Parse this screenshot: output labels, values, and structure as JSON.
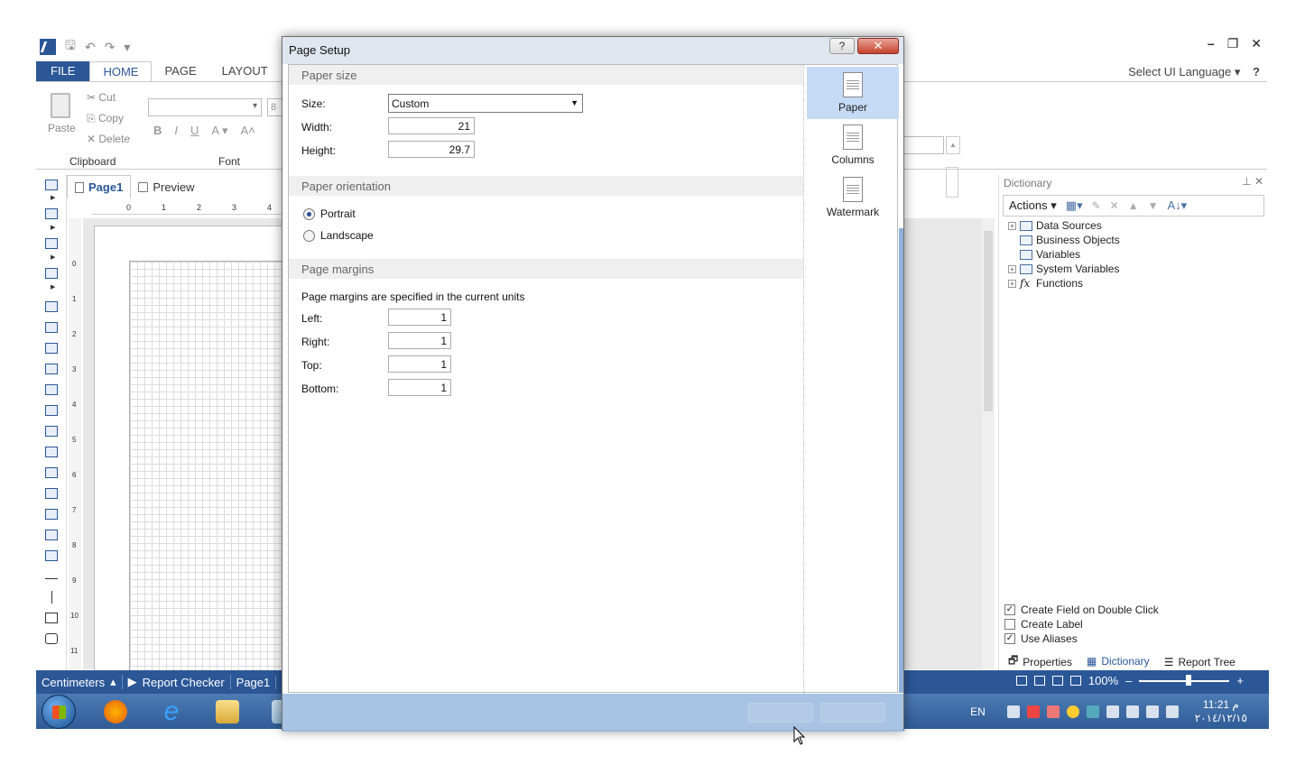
{
  "ribbon": {
    "tabs": [
      "FILE",
      "HOME",
      "PAGE",
      "LAYOUT"
    ],
    "ui_language": "Select UI Language",
    "help": "?",
    "clipboard": {
      "paste": "Paste",
      "cut": "Cut",
      "copy": "Copy",
      "delete": "Delete",
      "group": "Clipboard"
    },
    "font_group": "Font",
    "font_size": "8"
  },
  "doc_tabs": {
    "page1": "Page1",
    "preview": "Preview"
  },
  "ruler": {
    "top": [
      "0",
      "1",
      "2",
      "3",
      "4"
    ],
    "left": [
      "0",
      "1",
      "2",
      "3",
      "4",
      "5",
      "6",
      "7",
      "8",
      "9",
      "10",
      "11"
    ]
  },
  "dictionary": {
    "title": "Dictionary",
    "actions": "Actions",
    "tree": [
      "Data Sources",
      "Business Objects",
      "Variables",
      "System Variables",
      "Functions"
    ],
    "checks": [
      {
        "label": "Create Field on Double Click",
        "checked": true
      },
      {
        "label": "Create Label",
        "checked": false
      },
      {
        "label": "Use Aliases",
        "checked": true
      }
    ],
    "tabs": [
      "Properties",
      "Dictionary",
      "Report Tree"
    ]
  },
  "status": {
    "units": "Centimeters",
    "checker": "Report Checker",
    "page": "Page1",
    "zoom": "100%"
  },
  "dialog": {
    "title": "Page Setup",
    "paper_size_h": "Paper size",
    "size_label": "Size:",
    "size_value": "Custom",
    "width_label": "Width:",
    "width_value": "21",
    "height_label": "Height:",
    "height_value": "29.7",
    "orientation_h": "Paper orientation",
    "portrait": "Portrait",
    "landscape": "Landscape",
    "margins_h": "Page margins",
    "margins_note": "Page margins are specified in the current units",
    "left_label": "Left:",
    "left_value": "1",
    "right_label": "Right:",
    "right_value": "1",
    "top_label": "Top:",
    "top_value": "1",
    "bottom_label": "Bottom:",
    "bottom_value": "1",
    "side": [
      "Paper",
      "Columns",
      "Watermark"
    ]
  },
  "taskbar": {
    "lang": "EN",
    "time": "11:21 م",
    "date": "٢٠١٤/١٢/١٥"
  },
  "colors": {
    "accent": "#2b5797",
    "selected": "#c5daf5"
  }
}
